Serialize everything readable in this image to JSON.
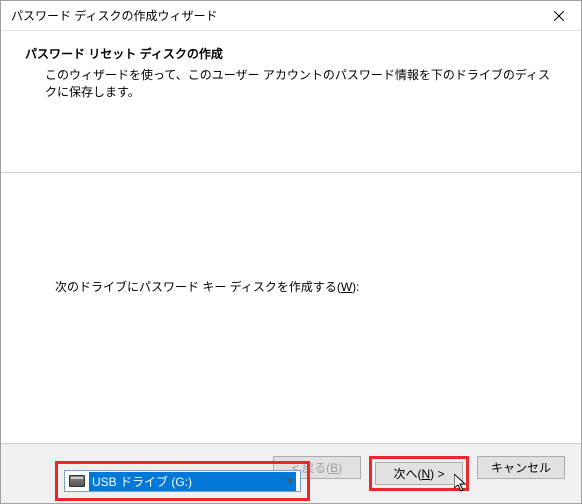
{
  "titlebar": {
    "title": "パスワード ディスクの作成ウィザード"
  },
  "header": {
    "title": "パスワード リセット ディスクの作成",
    "description": "このウィザードを使って、このユーザー アカウントのパスワード情報を下のドライブのディスクに保存します。"
  },
  "content": {
    "prompt_prefix": "次のドライブにパスワード キー ディスクを作成する(",
    "prompt_key": "W",
    "prompt_suffix": "):",
    "dropdown": {
      "selected": "USB ドライブ (G:)"
    }
  },
  "footer": {
    "back_prefix": "< 戻る(",
    "back_key": "B",
    "back_suffix": ")",
    "next_prefix": "次へ(",
    "next_key": "N",
    "next_suffix": ") >",
    "cancel": "キャンセル"
  }
}
